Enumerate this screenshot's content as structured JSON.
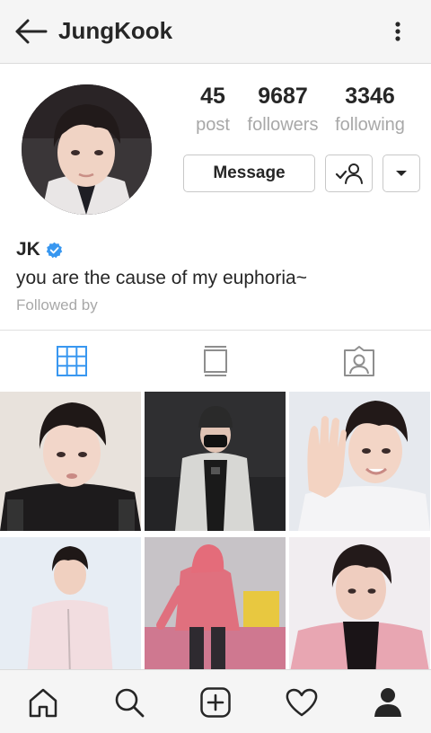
{
  "header": {
    "username": "JungKook"
  },
  "profile": {
    "display_name": "JK",
    "bio": "you are the cause of my euphoria~",
    "followed_by": "Followed by",
    "verified": true
  },
  "stats": {
    "posts": {
      "value": "45",
      "label": "post"
    },
    "followers": {
      "value": "9687",
      "label": "followers"
    },
    "following": {
      "value": "3346",
      "label": "following"
    }
  },
  "actions": {
    "message_label": "Message"
  },
  "tabs": [
    {
      "icon": "grid-icon",
      "active": true
    },
    {
      "icon": "feed-icon",
      "active": false
    },
    {
      "icon": "tagged-icon",
      "active": false
    }
  ],
  "posts_grid": [
    {
      "description": "photo-1"
    },
    {
      "description": "photo-2"
    },
    {
      "description": "photo-3"
    },
    {
      "description": "photo-4"
    },
    {
      "description": "photo-5"
    },
    {
      "description": "photo-6"
    }
  ],
  "bottom_nav": [
    {
      "icon": "home-icon"
    },
    {
      "icon": "search-icon"
    },
    {
      "icon": "add-post-icon"
    },
    {
      "icon": "heart-icon"
    },
    {
      "icon": "profile-icon"
    }
  ],
  "colors": {
    "accent": "#3897f0",
    "text": "#262626",
    "muted": "#a8a8a8",
    "bar_bg": "#f5f5f5"
  }
}
